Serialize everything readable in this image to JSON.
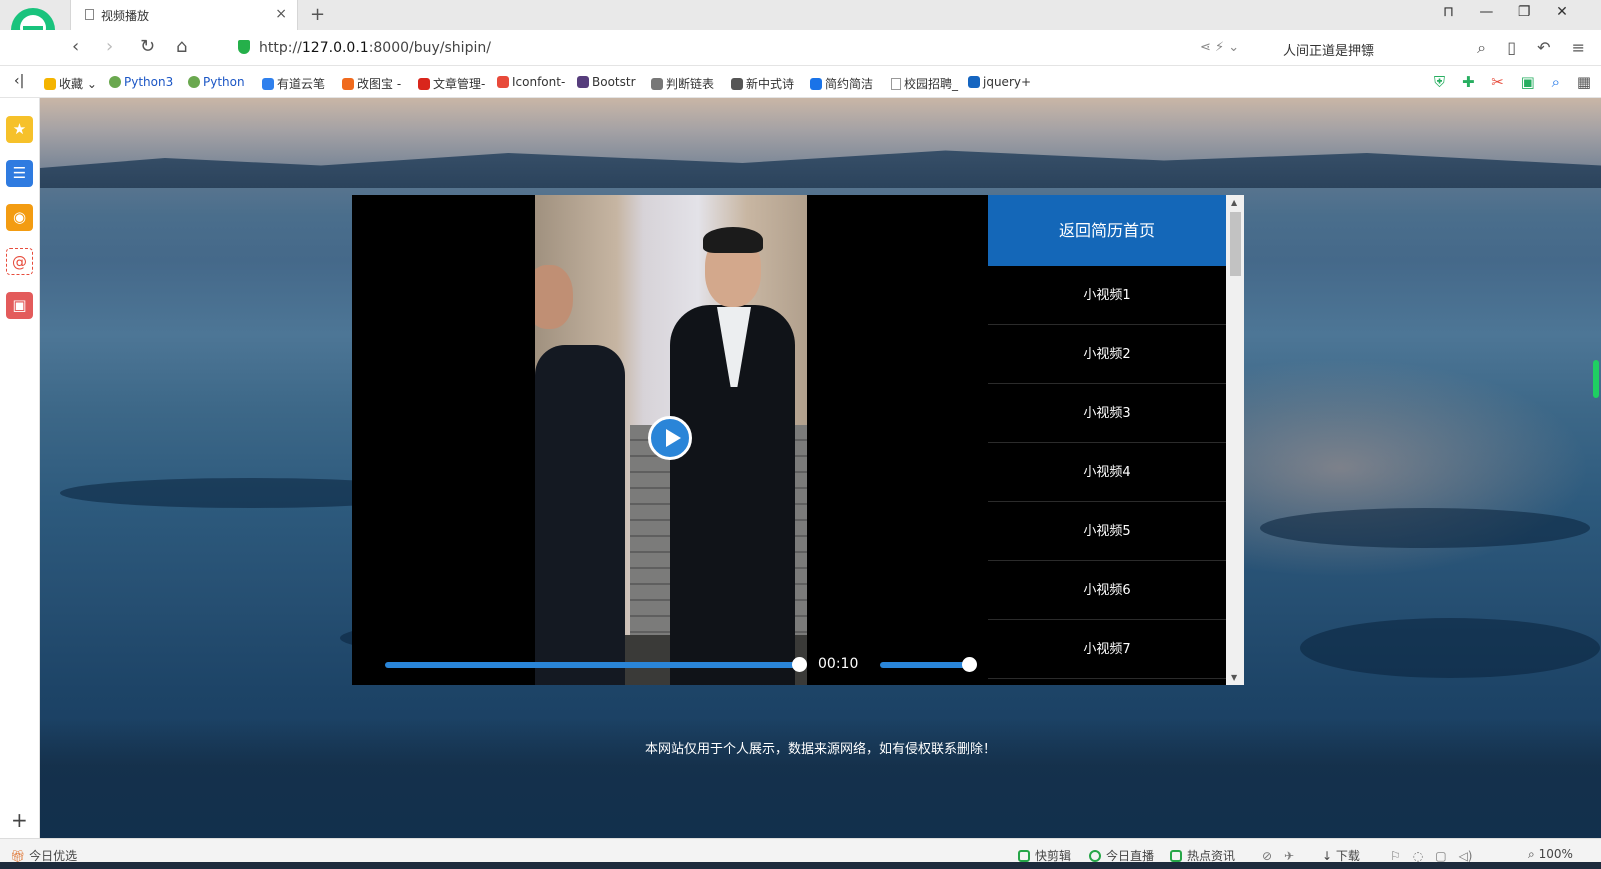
{
  "browser": {
    "tab_title": "视频播放",
    "tab_close": "×",
    "new_tab": "+",
    "url_prefix": "http://",
    "url_host": "127.0.0.1",
    "url_rest": ":8000/buy/shipin/",
    "search_text": "人间正道是押镖",
    "window_buttons": [
      "⊓",
      "—",
      "❐",
      "✕"
    ]
  },
  "bookmarks": [
    {
      "label": "收藏",
      "color": "#f4b400"
    },
    {
      "label": "Python3",
      "color": "#6aa84f",
      "blue": true
    },
    {
      "label": "Python",
      "color": "#6aa84f",
      "blue": true
    },
    {
      "label": "有道云笔",
      "color": "#2f80ed"
    },
    {
      "label": "改图宝 -",
      "color": "#f06a1d"
    },
    {
      "label": "文章管理-",
      "color": "#d9261c"
    },
    {
      "label": "Iconfont-",
      "color": "#e84a3a"
    },
    {
      "label": "Bootstr",
      "color": "#563d7c"
    },
    {
      "label": "判断链表",
      "color": "#555555"
    },
    {
      "label": "新中式诗",
      "color": "#555555"
    },
    {
      "label": "简约简洁",
      "color": "#1a73e8"
    },
    {
      "label": "校园招聘_",
      "color": "#999999"
    },
    {
      "label": "jquery+",
      "color": "#1565c0"
    }
  ],
  "player": {
    "time": "00:10",
    "progress": 1.0,
    "volume": 1.0,
    "back_label": "返回简历首页",
    "videos": [
      "小视频1",
      "小视频2",
      "小视频3",
      "小视频4",
      "小视频5",
      "小视频6",
      "小视频7"
    ]
  },
  "footer": {
    "disclaimer": "本网站仅用于个人展示，数据来源网络，如有侵权联系删除！"
  },
  "statusbar": {
    "left": "今日优选",
    "items": [
      "快剪辑",
      "今日直播",
      "热点资讯",
      "下载"
    ],
    "zoom": "100%"
  },
  "colors": {
    "accent": "#1467b8",
    "progress": "#2a85d8",
    "secure": "#25b04a"
  }
}
